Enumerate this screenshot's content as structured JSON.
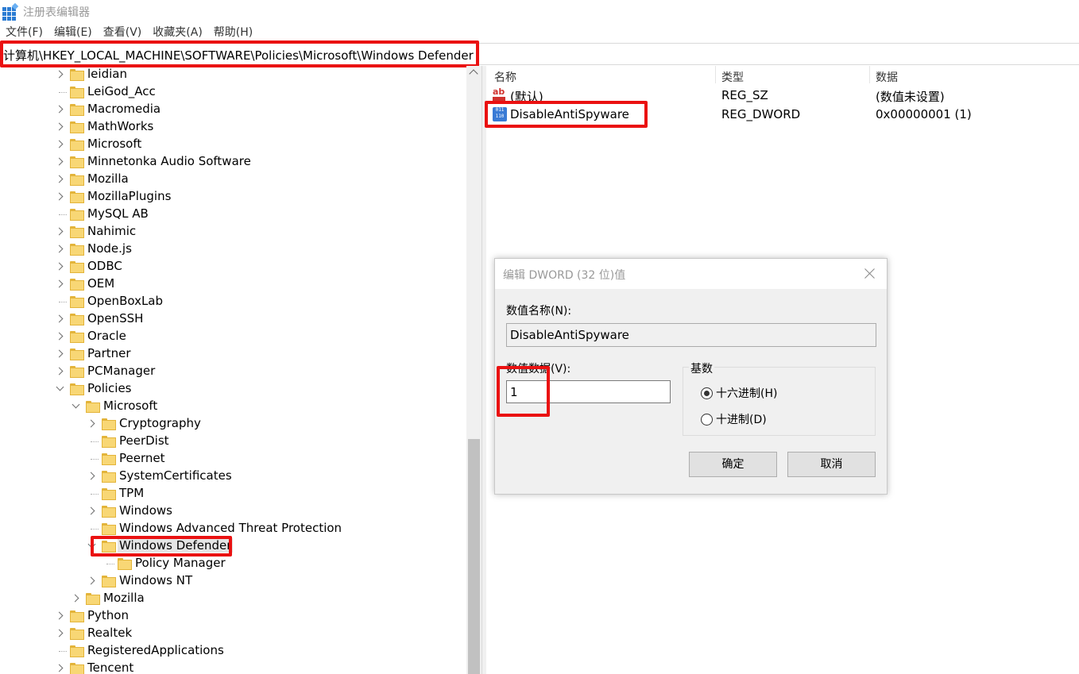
{
  "window": {
    "title": "注册表编辑器"
  },
  "menu": [
    "文件(F)",
    "编辑(E)",
    "查看(V)",
    "收藏夹(A)",
    "帮助(H)"
  ],
  "address": "计算机\\HKEY_LOCAL_MACHINE\\SOFTWARE\\Policies\\Microsoft\\Windows Defender",
  "tree": [
    {
      "label": "leidian",
      "exp": "closed"
    },
    {
      "label": "LeiGod_Acc",
      "exp": "none"
    },
    {
      "label": "Macromedia",
      "exp": "closed"
    },
    {
      "label": "MathWorks",
      "exp": "closed"
    },
    {
      "label": "Microsoft",
      "exp": "closed"
    },
    {
      "label": "Minnetonka Audio Software",
      "exp": "closed"
    },
    {
      "label": "Mozilla",
      "exp": "closed"
    },
    {
      "label": "MozillaPlugins",
      "exp": "closed"
    },
    {
      "label": "MySQL AB",
      "exp": "none"
    },
    {
      "label": "Nahimic",
      "exp": "closed"
    },
    {
      "label": "Node.js",
      "exp": "closed"
    },
    {
      "label": "ODBC",
      "exp": "closed"
    },
    {
      "label": "OEM",
      "exp": "closed"
    },
    {
      "label": "OpenBoxLab",
      "exp": "none"
    },
    {
      "label": "OpenSSH",
      "exp": "closed"
    },
    {
      "label": "Oracle",
      "exp": "closed"
    },
    {
      "label": "Partner",
      "exp": "closed"
    },
    {
      "label": "PCManager",
      "exp": "closed"
    },
    {
      "label": "Policies",
      "exp": "open"
    },
    {
      "label": "Microsoft",
      "exp": "open",
      "depth": 1
    },
    {
      "label": "Cryptography",
      "exp": "closed",
      "depth": 2
    },
    {
      "label": "PeerDist",
      "exp": "none",
      "depth": 2
    },
    {
      "label": "Peernet",
      "exp": "none",
      "depth": 2
    },
    {
      "label": "SystemCertificates",
      "exp": "closed",
      "depth": 2
    },
    {
      "label": "TPM",
      "exp": "none",
      "depth": 2
    },
    {
      "label": "Windows",
      "exp": "closed",
      "depth": 2
    },
    {
      "label": "Windows Advanced Threat Protection",
      "exp": "none",
      "depth": 2
    },
    {
      "label": "Windows Defender",
      "exp": "open",
      "depth": 2,
      "selected": true
    },
    {
      "label": "Policy Manager",
      "exp": "none",
      "depth": 3
    },
    {
      "label": "Windows NT",
      "exp": "closed",
      "depth": 2
    },
    {
      "label": "Mozilla",
      "exp": "closed",
      "depth": 1
    },
    {
      "label": "Python",
      "exp": "closed"
    },
    {
      "label": "Realtek",
      "exp": "closed"
    },
    {
      "label": "RegisteredApplications",
      "exp": "none"
    },
    {
      "label": "Tencent",
      "exp": "closed"
    }
  ],
  "values_pane": {
    "headers": {
      "name": "名称",
      "type": "类型",
      "data": "数据"
    },
    "rows": [
      {
        "icon": "string-value-icon",
        "name": "(默认)",
        "type": "REG_SZ",
        "data": "(数值未设置)"
      },
      {
        "icon": "binary-value-icon",
        "name": "DisableAntiSpyware",
        "type": "REG_DWORD",
        "data": "0x00000001 (1)"
      }
    ]
  },
  "dialog": {
    "title": "编辑 DWORD (32 位)值",
    "name_label": "数值名称(N):",
    "name_value": "DisableAntiSpyware",
    "data_label": "数值数据(V):",
    "data_value": "1",
    "base_label": "基数",
    "hex_label": "十六进制(H)",
    "dec_label": "十进制(D)",
    "selected_base": "hex",
    "ok_label": "确定",
    "cancel_label": "取消"
  },
  "highlight_color": "#ea1111"
}
